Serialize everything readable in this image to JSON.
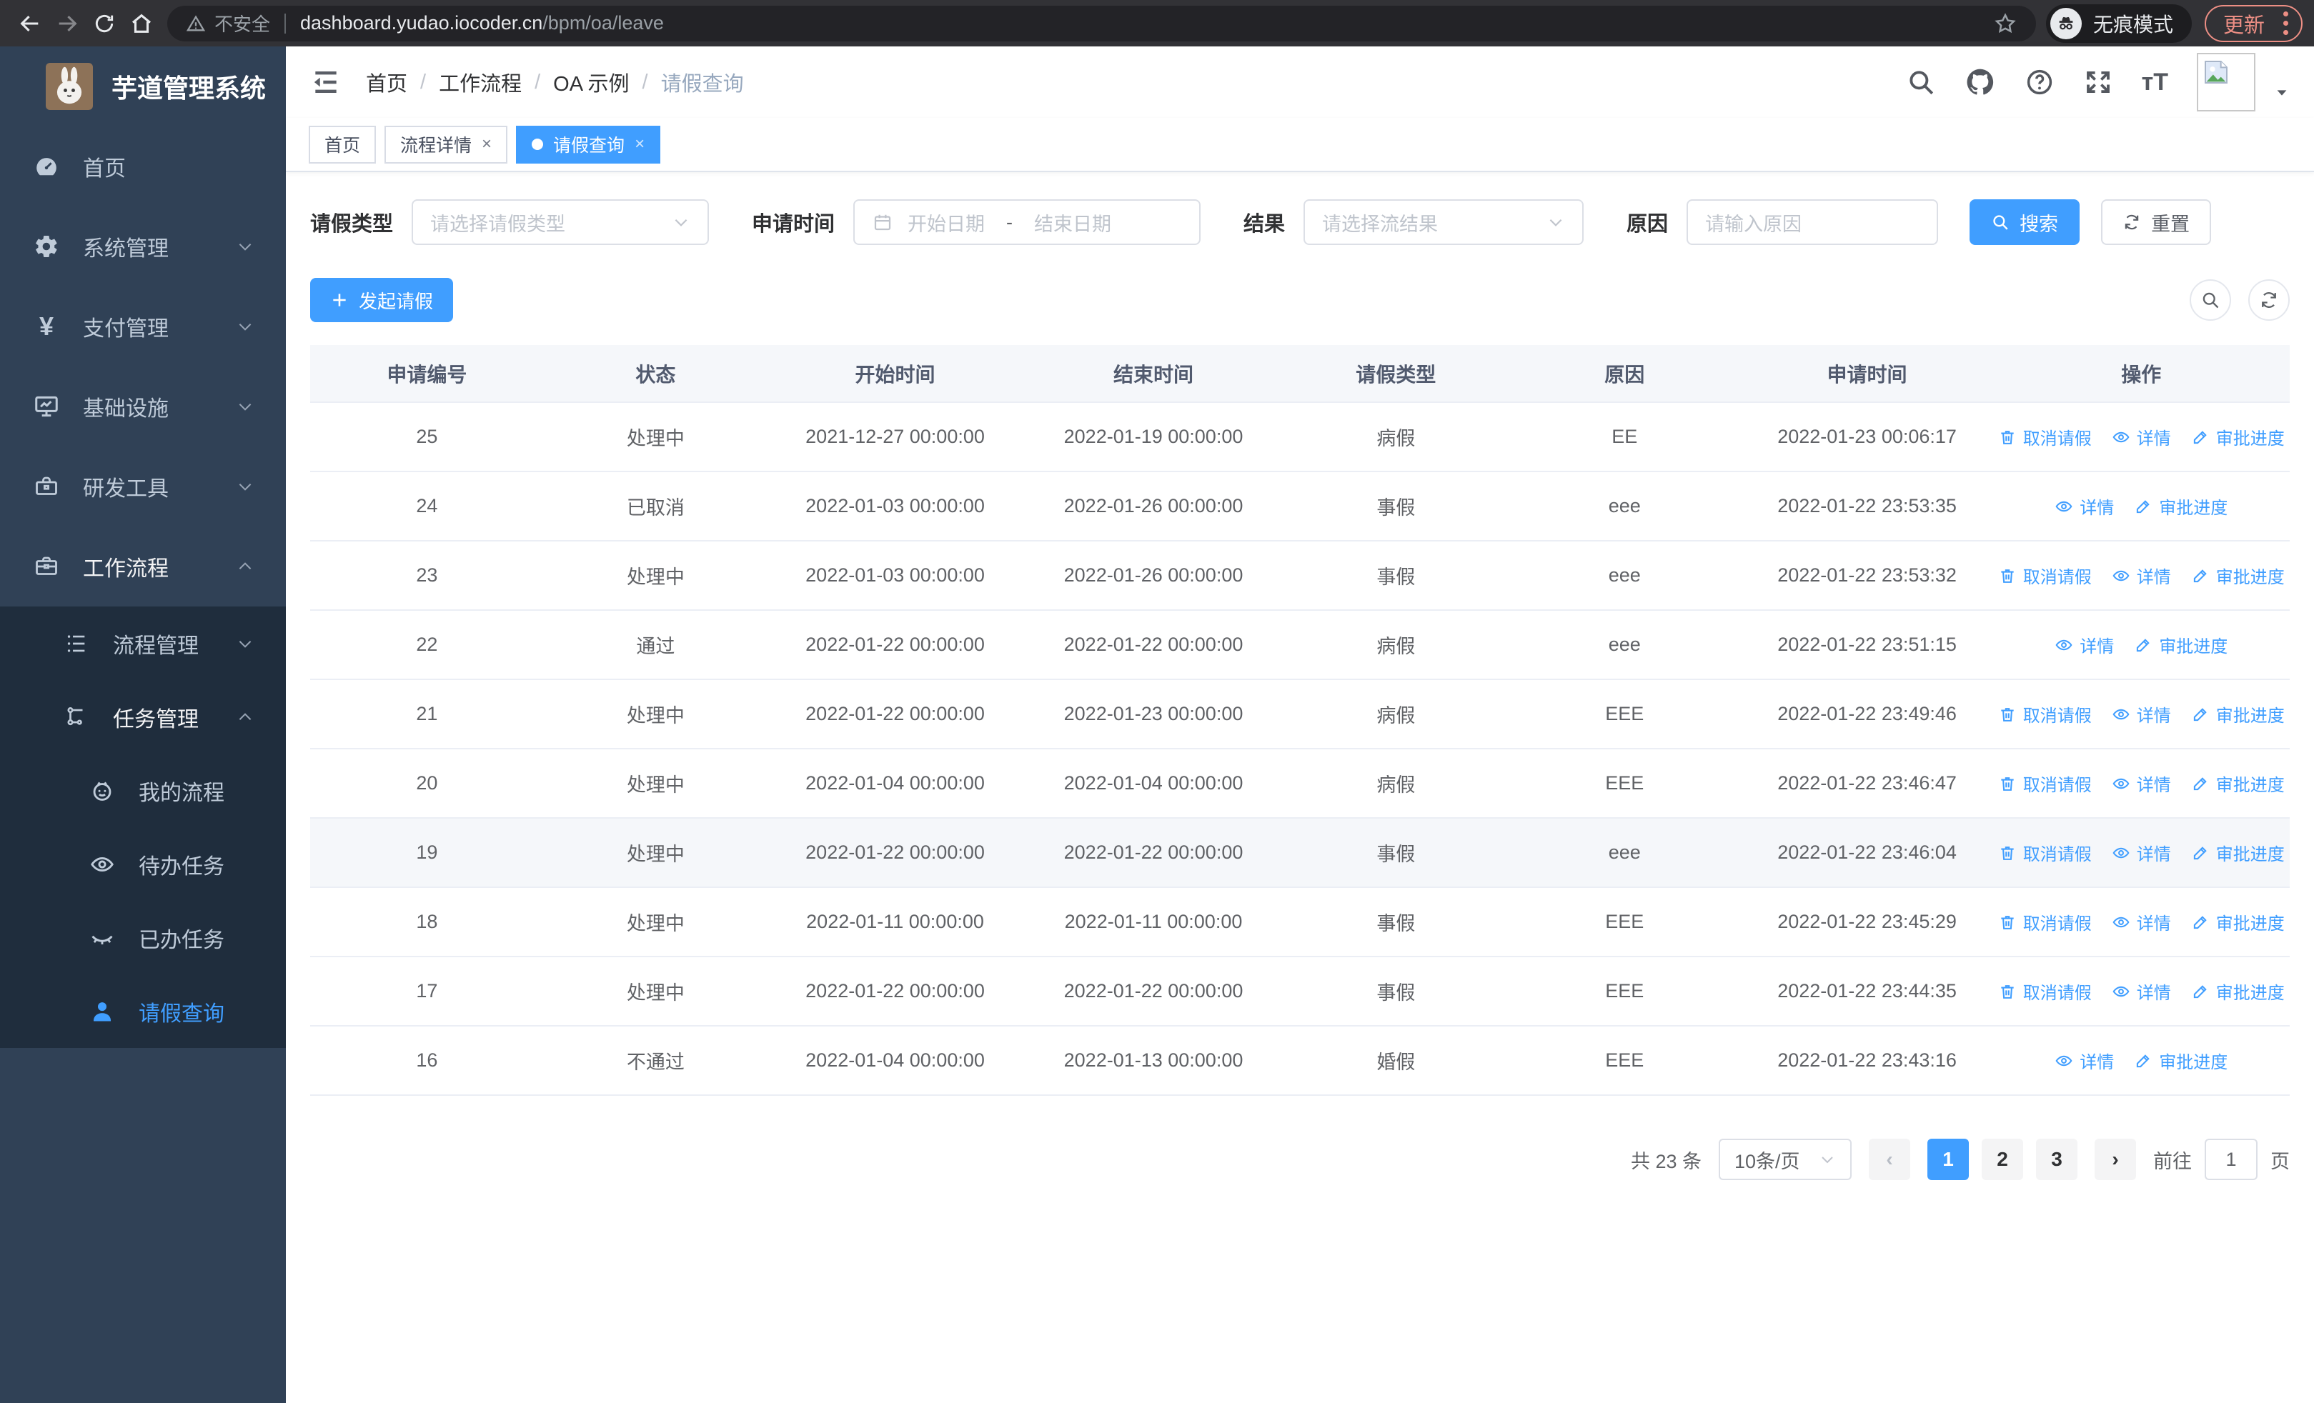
{
  "browser": {
    "security_label": "不安全",
    "url_host": "dashboard.yudao.iocoder.cn",
    "url_path": "/bpm/oa/leave",
    "incognito_label": "无痕模式",
    "update_label": "更新"
  },
  "colors": {
    "accent": "#409eff",
    "sidebar_bg": "#304156",
    "submenu_bg": "#1f2d3d",
    "table_header_bg": "#f5f7fa",
    "update_pill": "#ec8e84"
  },
  "sidebar": {
    "title": "芋道管理系统",
    "items": [
      {
        "label": "首页",
        "icon": "dashboard-icon",
        "level": 1
      },
      {
        "label": "系统管理",
        "icon": "gear-icon",
        "level": 1,
        "chevron": "down"
      },
      {
        "label": "支付管理",
        "icon": "yen-icon",
        "level": 1,
        "chevron": "down"
      },
      {
        "label": "基础设施",
        "icon": "monitor-icon",
        "level": 1,
        "chevron": "down"
      },
      {
        "label": "研发工具",
        "icon": "toolbox-icon",
        "level": 1,
        "chevron": "down"
      },
      {
        "label": "工作流程",
        "icon": "briefcase-icon",
        "level": 1,
        "chevron": "up",
        "open": true
      },
      {
        "label": "流程管理",
        "icon": "list-icon",
        "level": 2,
        "chevron": "down",
        "dark": true
      },
      {
        "label": "任务管理",
        "icon": "flow-icon",
        "level": 2,
        "chevron": "up",
        "dark": true,
        "open": true
      },
      {
        "label": "我的流程",
        "icon": "face-icon",
        "level": 3,
        "dark": true
      },
      {
        "label": "待办任务",
        "icon": "eye-icon",
        "level": 3,
        "dark": true
      },
      {
        "label": "已办任务",
        "icon": "eye-closed-icon",
        "level": 3,
        "dark": true
      },
      {
        "label": "请假查询",
        "icon": "user-icon",
        "level": 3,
        "dark": true,
        "active": true
      }
    ]
  },
  "breadcrumb": {
    "items": [
      "首页",
      "工作流程",
      "OA 示例",
      "请假查询"
    ]
  },
  "tabs": [
    {
      "label": "首页"
    },
    {
      "label": "流程详情",
      "closable": true
    },
    {
      "label": "请假查询",
      "closable": true,
      "active": true
    }
  ],
  "filters": {
    "leave_type_label": "请假类型",
    "leave_type_placeholder": "请选择请假类型",
    "apply_time_label": "申请时间",
    "start_date_placeholder": "开始日期",
    "range_separator": "-",
    "end_date_placeholder": "结束日期",
    "result_label": "结果",
    "result_placeholder": "请选择流结果",
    "reason_label": "原因",
    "reason_placeholder": "请输入原因",
    "search_label": "搜索",
    "reset_label": "重置"
  },
  "toolbar": {
    "create_label": "发起请假"
  },
  "table": {
    "headers": [
      "申请编号",
      "状态",
      "开始时间",
      "结束时间",
      "请假类型",
      "原因",
      "申请时间",
      "操作"
    ],
    "action_labels": {
      "cancel": "取消请假",
      "detail": "详情",
      "progress": "审批进度"
    },
    "rows": [
      {
        "id": "25",
        "status": "处理中",
        "start": "2021-12-27 00:00:00",
        "end": "2022-01-19 00:00:00",
        "type": "病假",
        "reason": "EE",
        "apply_time": "2022-01-23 00:06:17",
        "actions": [
          "cancel",
          "detail",
          "progress"
        ]
      },
      {
        "id": "24",
        "status": "已取消",
        "start": "2022-01-03 00:00:00",
        "end": "2022-01-26 00:00:00",
        "type": "事假",
        "reason": "eee",
        "apply_time": "2022-01-22 23:53:35",
        "actions": [
          "detail",
          "progress"
        ]
      },
      {
        "id": "23",
        "status": "处理中",
        "start": "2022-01-03 00:00:00",
        "end": "2022-01-26 00:00:00",
        "type": "事假",
        "reason": "eee",
        "apply_time": "2022-01-22 23:53:32",
        "actions": [
          "cancel",
          "detail",
          "progress"
        ]
      },
      {
        "id": "22",
        "status": "通过",
        "start": "2022-01-22 00:00:00",
        "end": "2022-01-22 00:00:00",
        "type": "病假",
        "reason": "eee",
        "apply_time": "2022-01-22 23:51:15",
        "actions": [
          "detail",
          "progress"
        ]
      },
      {
        "id": "21",
        "status": "处理中",
        "start": "2022-01-22 00:00:00",
        "end": "2022-01-23 00:00:00",
        "type": "病假",
        "reason": "EEE",
        "apply_time": "2022-01-22 23:49:46",
        "actions": [
          "cancel",
          "detail",
          "progress"
        ]
      },
      {
        "id": "20",
        "status": "处理中",
        "start": "2022-01-04 00:00:00",
        "end": "2022-01-04 00:00:00",
        "type": "病假",
        "reason": "EEE",
        "apply_time": "2022-01-22 23:46:47",
        "actions": [
          "cancel",
          "detail",
          "progress"
        ]
      },
      {
        "id": "19",
        "status": "处理中",
        "start": "2022-01-22 00:00:00",
        "end": "2022-01-22 00:00:00",
        "type": "事假",
        "reason": "eee",
        "apply_time": "2022-01-22 23:46:04",
        "actions": [
          "cancel",
          "detail",
          "progress"
        ],
        "highlighted": true
      },
      {
        "id": "18",
        "status": "处理中",
        "start": "2022-01-11 00:00:00",
        "end": "2022-01-11 00:00:00",
        "type": "事假",
        "reason": "EEE",
        "apply_time": "2022-01-22 23:45:29",
        "actions": [
          "cancel",
          "detail",
          "progress"
        ]
      },
      {
        "id": "17",
        "status": "处理中",
        "start": "2022-01-22 00:00:00",
        "end": "2022-01-22 00:00:00",
        "type": "事假",
        "reason": "EEE",
        "apply_time": "2022-01-22 23:44:35",
        "actions": [
          "cancel",
          "detail",
          "progress"
        ]
      },
      {
        "id": "16",
        "status": "不通过",
        "start": "2022-01-04 00:00:00",
        "end": "2022-01-13 00:00:00",
        "type": "婚假",
        "reason": "EEE",
        "apply_time": "2022-01-22 23:43:16",
        "actions": [
          "detail",
          "progress"
        ]
      }
    ]
  },
  "pagination": {
    "total": "共 23 条",
    "page_size": "10条/页",
    "pages": [
      "1",
      "2",
      "3"
    ],
    "active_page": "1",
    "goto_label": "前往",
    "goto_value": "1",
    "unit_label": "页"
  }
}
